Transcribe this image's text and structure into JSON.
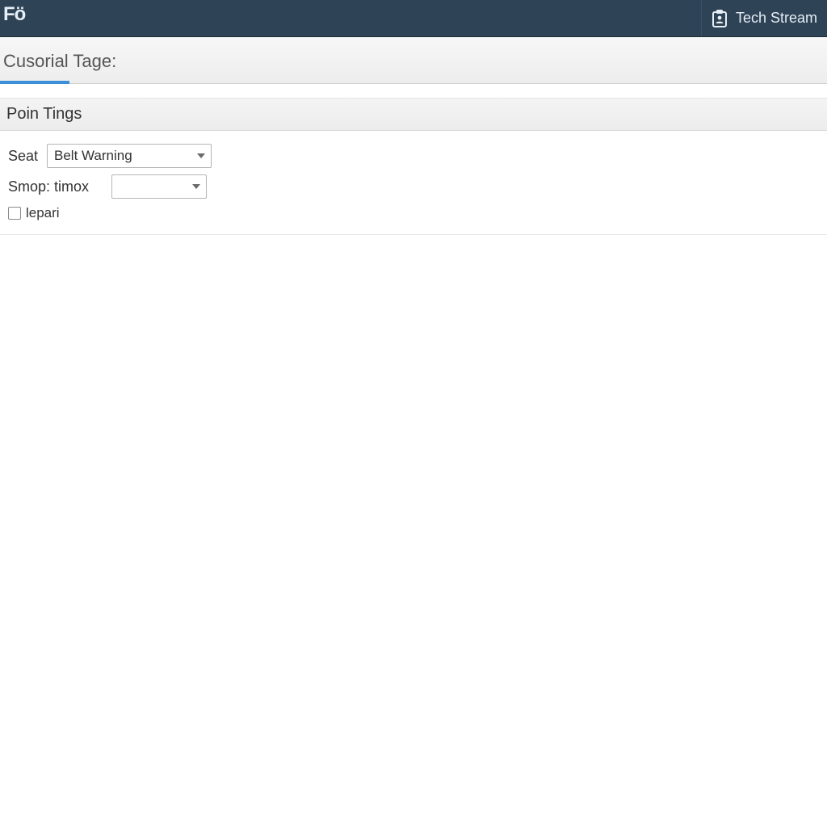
{
  "header": {
    "logo_text": "Fö",
    "right_label": "Tech Stream"
  },
  "tabs": {
    "active_label": "Cusorial Tage:"
  },
  "section": {
    "title": "Poin Tings"
  },
  "form": {
    "seat_label": "Seat",
    "seat_value": "Belt Warning",
    "smop_label": "Smop: timox",
    "smop_value": "",
    "lepari_label": "lepari",
    "lepari_checked": false
  }
}
